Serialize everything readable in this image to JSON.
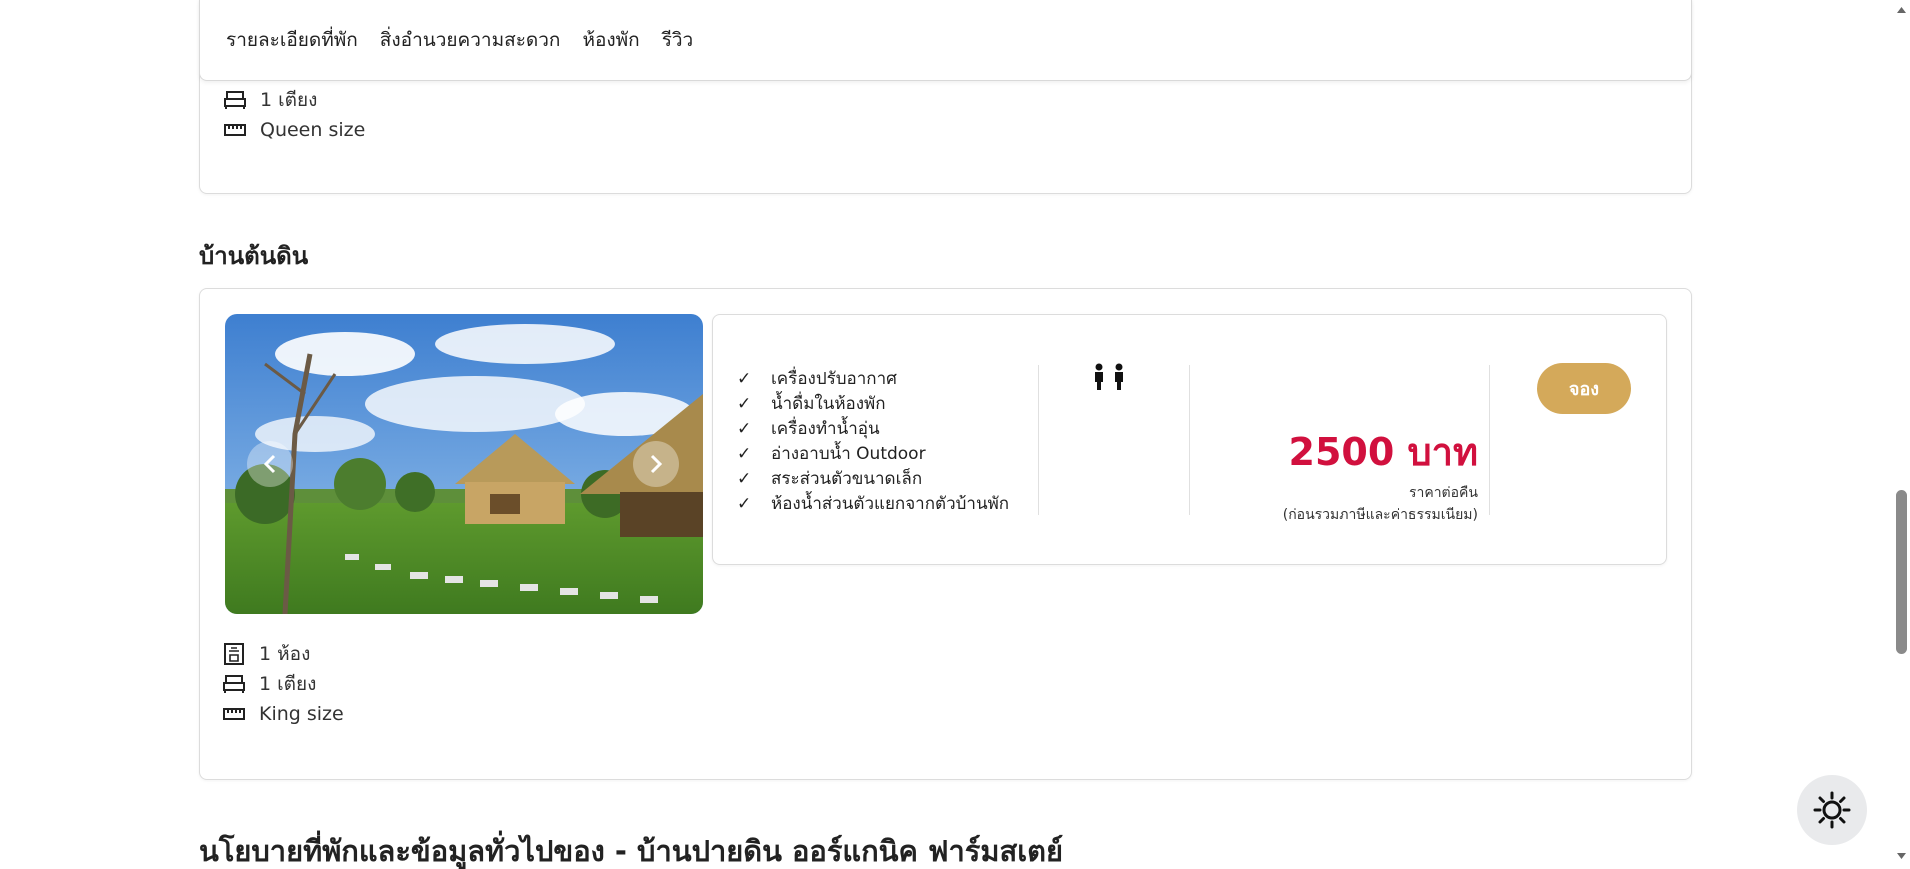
{
  "tabs": [
    {
      "label": "รายละเอียดที่พัก"
    },
    {
      "label": "สิ่งอำนวยความสะดวก"
    },
    {
      "label": "ห้องพัก"
    },
    {
      "label": "รีวิว"
    }
  ],
  "prev_room": {
    "beds": "1 เตียง",
    "bed_size": "Queen size"
  },
  "room": {
    "title": "บ้านต้นดิน",
    "amenities": [
      "เครื่องปรับอากาศ",
      "น้ำดื่มในห้องพัก",
      "เครื่องทำน้ำอุ่น",
      "อ่างอาบน้ำ Outdoor",
      "สระส่วนตัวขนาดเล็ก",
      "ห้องน้ำส่วนตัวแยกจากตัวบ้านพัก"
    ],
    "check_mark": "✓",
    "guests": 2,
    "price": "2500 บาท",
    "price_unit": "ราคาต่อคืน",
    "price_note": "(ก่อนรวมภาษีและค่าธรรมเนียม)",
    "book_label": "จอง",
    "rooms": "1 ห้อง",
    "beds": "1 เตียง",
    "bed_size": "King size"
  },
  "policy_title": "นโยบายที่พักและข้อมูลทั่วไปของ - บ้านปายดิน ออร์แกนิค ฟาร์มสเตย์",
  "colors": {
    "price": "#d1103e",
    "book_button": "#d4a95a",
    "theme_button_bg": "#e9eaec"
  },
  "icons": {
    "bed": "bed-icon",
    "ruler": "ruler-icon",
    "room": "room-icon",
    "guest": "person-icon",
    "prev": "chevron-left-icon",
    "next": "chevron-right-icon",
    "theme": "sun-icon"
  }
}
